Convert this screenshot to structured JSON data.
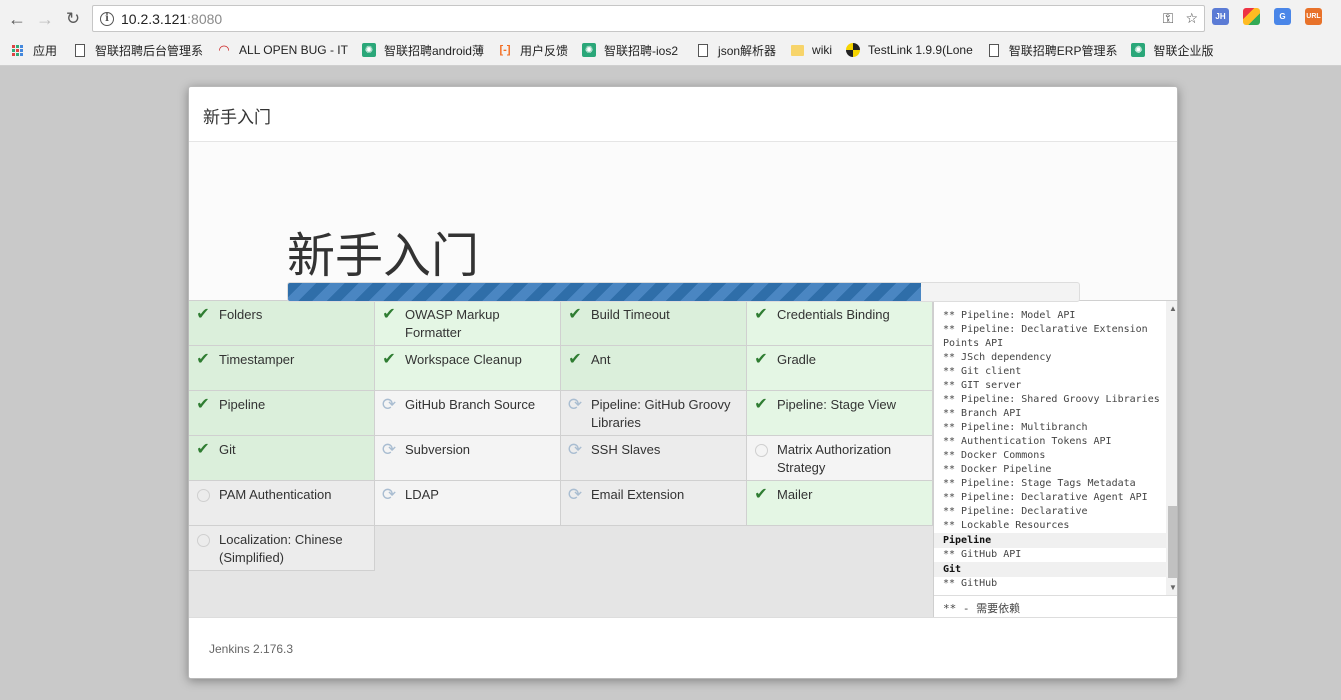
{
  "browser": {
    "url_host": "10.2.3.121",
    "url_port": ":8080",
    "bookmarks": [
      {
        "label": "应用",
        "icon": "apps-grid-icon"
      },
      {
        "label": "智联招聘后台管理系",
        "icon": "document-icon"
      },
      {
        "label": "ALL OPEN BUG - IT",
        "icon": "jira-icon"
      },
      {
        "label": "智联招聘android薄",
        "icon": "green-app-icon"
      },
      {
        "label": "用户反馈",
        "icon": "orange-bracket-icon"
      },
      {
        "label": "智联招聘-ios2",
        "icon": "green-app-icon"
      },
      {
        "label": "json解析器",
        "icon": "document-icon"
      },
      {
        "label": "wiki",
        "icon": "folder-icon"
      },
      {
        "label": "TestLink 1.9.9(Lone",
        "icon": "testlink-icon"
      },
      {
        "label": "智联招聘ERP管理系",
        "icon": "document-icon"
      },
      {
        "label": "智联企业版",
        "icon": "green-app-icon"
      }
    ],
    "extensions": [
      "JH",
      "",
      "G",
      "URL"
    ]
  },
  "dialog": {
    "header_title": "新手入门",
    "hero_title": "新手入门",
    "progress_percent": 80,
    "footer_version": "Jenkins 2.176.3"
  },
  "plugins": [
    {
      "name": "Folders",
      "status": "success"
    },
    {
      "name": "OWASP Markup Formatter",
      "status": "success"
    },
    {
      "name": "Build Timeout",
      "status": "success"
    },
    {
      "name": "Credentials Binding",
      "status": "success"
    },
    {
      "name": "Timestamper",
      "status": "success"
    },
    {
      "name": "Workspace Cleanup",
      "status": "success"
    },
    {
      "name": "Ant",
      "status": "success"
    },
    {
      "name": "Gradle",
      "status": "success"
    },
    {
      "name": "Pipeline",
      "status": "success"
    },
    {
      "name": "GitHub Branch Source",
      "status": "installing"
    },
    {
      "name": "Pipeline: GitHub Groovy Libraries",
      "status": "installing"
    },
    {
      "name": "Pipeline: Stage View",
      "status": "success"
    },
    {
      "name": "Git",
      "status": "success"
    },
    {
      "name": "Subversion",
      "status": "installing"
    },
    {
      "name": "SSH Slaves",
      "status": "installing"
    },
    {
      "name": "Matrix Authorization Strategy",
      "status": "pending"
    },
    {
      "name": "PAM Authentication",
      "status": "pending"
    },
    {
      "name": "LDAP",
      "status": "installing"
    },
    {
      "name": "Email Extension",
      "status": "installing"
    },
    {
      "name": "Mailer",
      "status": "success"
    },
    {
      "name": "Localization: Chinese (Simplified)",
      "status": "pending"
    }
  ],
  "install_log": [
    {
      "text": "** Pipeline: Model API",
      "strong": false
    },
    {
      "text": "** Pipeline: Declarative Extension",
      "strong": false
    },
    {
      "text": "Points API",
      "strong": false
    },
    {
      "text": "** JSch dependency",
      "strong": false
    },
    {
      "text": "** Git client",
      "strong": false
    },
    {
      "text": "** GIT server",
      "strong": false
    },
    {
      "text": "** Pipeline: Shared Groovy Libraries",
      "strong": false
    },
    {
      "text": "** Branch API",
      "strong": false
    },
    {
      "text": "** Pipeline: Multibranch",
      "strong": false
    },
    {
      "text": "** Authentication Tokens API",
      "strong": false
    },
    {
      "text": "** Docker Commons",
      "strong": false
    },
    {
      "text": "** Docker Pipeline",
      "strong": false
    },
    {
      "text": "** Pipeline: Stage Tags Metadata",
      "strong": false
    },
    {
      "text": "** Pipeline: Declarative Agent API",
      "strong": false
    },
    {
      "text": "** Pipeline: Declarative",
      "strong": false
    },
    {
      "text": "** Lockable Resources",
      "strong": false
    },
    {
      "text": "Pipeline",
      "strong": true
    },
    {
      "text": "** GitHub API",
      "strong": false
    },
    {
      "text": "Git",
      "strong": true
    },
    {
      "text": "** GitHub",
      "strong": false
    }
  ],
  "log_footer": "** - 需要依赖"
}
